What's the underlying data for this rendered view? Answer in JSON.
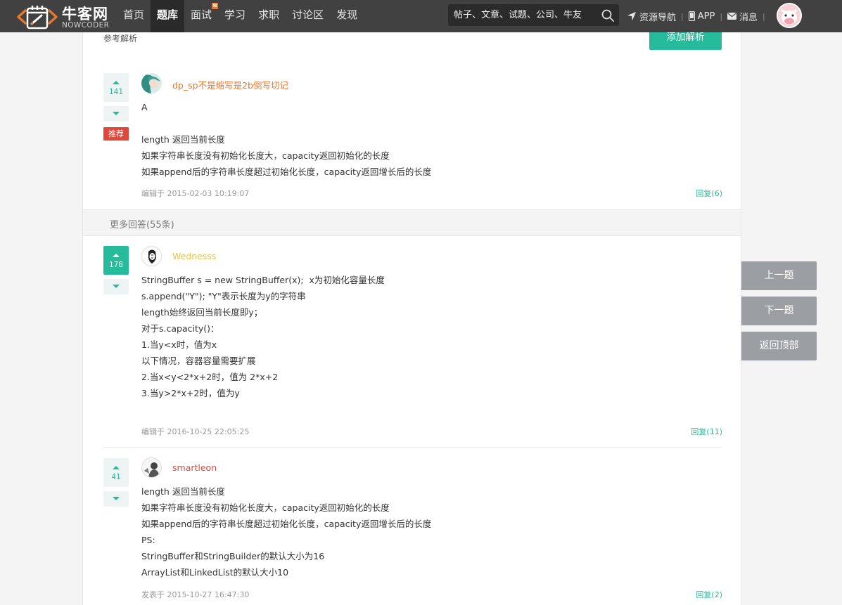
{
  "header": {
    "logo_cn": "牛客网",
    "logo_en": "NOWCODER",
    "nav": [
      {
        "label": "首页",
        "active": false
      },
      {
        "label": "题库",
        "active": true
      },
      {
        "label": "面试",
        "active": false,
        "badge": "N"
      },
      {
        "label": "学习",
        "active": false
      },
      {
        "label": "求职",
        "active": false
      },
      {
        "label": "讨论区",
        "active": false
      },
      {
        "label": "发现",
        "active": false
      }
    ],
    "search_placeholder": "帖子、文章、试题、公司、牛友",
    "resource_nav": "资源导航",
    "app": "APP",
    "messages": "消息"
  },
  "section": {
    "label": "参考解析",
    "add_button": "添加解析"
  },
  "answers": [
    {
      "votes": "141",
      "voted": false,
      "recommended": "推荐",
      "user": "dp_sp不是缩写是2b倒写切记",
      "user_color": "#e8772e",
      "lines": [
        "A",
        "",
        "length 返回当前长度",
        "如果字符串长度没有初始化长度大，capacity返回初始化的长度",
        "如果append后的字符串长度超过初始化长度，capacity返回增长后的长度"
      ],
      "meta": "编辑于 2015-02-03 10:19:07",
      "reply": "回复(6)"
    }
  ],
  "more": {
    "label": "更多回答(55条)"
  },
  "more_answers": [
    {
      "votes": "178",
      "voted": true,
      "user": "Wednesss",
      "user_color": "#e8c34a",
      "lines": [
        "StringBuffer s = new StringBuffer(x);  x为初始化容量长度",
        "s.append(\"Y\"); \"Y\"表示长度为y的字符串",
        "length始终返回当前长度即y；",
        "对于s.capacity()：",
        "1.当y<x时，值为x",
        "以下情况，容器容量需要扩展",
        "2.当x<y<2*x+2时，值为 2*x+2",
        "3.当y>2*x+2时，值为y"
      ],
      "meta": "编辑于 2016-10-25 22:05:25",
      "reply": "回复(11)"
    },
    {
      "votes": "41",
      "voted": false,
      "user": "smartleon",
      "user_color": "#e0463a",
      "lines": [
        "length 返回当前长度",
        "如果字符串长度没有初始化长度大，capacity返回初始化的长度",
        "如果append后的字符串长度超过初始化长度，capacity返回增长后的长度",
        "PS:",
        "StringBuffer和StringBuilder的默认大小为16",
        "ArrayList和LinkedList的默认大小10"
      ],
      "meta": "发表于 2015-10-27 16:47:30",
      "reply": "回复(2)"
    }
  ],
  "side": {
    "prev": "上一题",
    "next": "下一题",
    "top": "返回顶部"
  },
  "colors": {
    "accent": "#25bb9b",
    "topbar": "#414141",
    "recommend": "#e0463a"
  }
}
